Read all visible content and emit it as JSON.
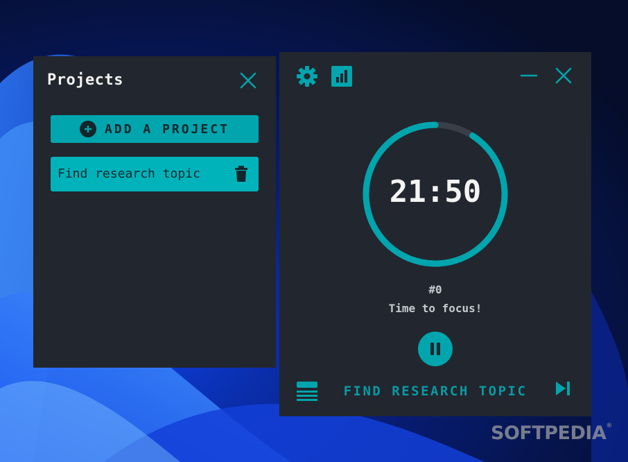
{
  "colors": {
    "accent": "#00a5ad",
    "accent_light": "#00b3bb",
    "panel_bg": "#22262e",
    "ring_track": "#3a3e46",
    "text_light": "#f2f2f2",
    "text_muted": "#c6c9cf",
    "text_dark": "#13262b"
  },
  "projects_panel": {
    "title": "Projects",
    "close_icon": "close-icon",
    "add_button": {
      "label": "ADD A PROJECT",
      "icon": "plus-circle-icon"
    },
    "items": [
      {
        "name": "Find research topic",
        "delete_icon": "trash-icon"
      }
    ]
  },
  "timer_panel": {
    "toolbar_icons": [
      "gear-icon",
      "bar-chart-icon"
    ],
    "window_icons": [
      "minimize-icon",
      "close-icon"
    ],
    "time": "21:50",
    "progress_remaining": 0.91,
    "session_number": "#0",
    "status": "Time to focus!",
    "pause_icon": "pause-icon",
    "menu_icon": "menu-icon",
    "current_project": "FIND RESEARCH TOPIC",
    "skip_icon": "skip-next-icon"
  },
  "watermark": {
    "text": "SOFTPEDIA",
    "mark": "®"
  }
}
